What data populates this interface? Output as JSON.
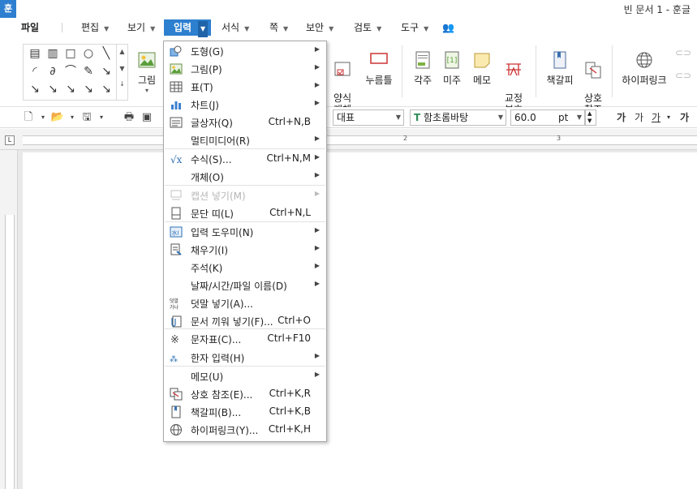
{
  "app": {
    "logo": "훈",
    "title": "빈 문서 1 - 훈글"
  },
  "menubar": {
    "file": "파일",
    "items": [
      "편집",
      "보기",
      "입력",
      "서식",
      "쪽",
      "보안",
      "검토",
      "도구"
    ]
  },
  "ribbon": {
    "picture": "그림",
    "form_object": "양식\n개체",
    "push_button": "누름틀",
    "footnote": "각주",
    "endnote": "미주",
    "memo": "메모",
    "proofread": "교정\n부호",
    "bookmark": "책갈피",
    "cross_ref": "상호\n참조",
    "hyperlink": "하이퍼링크"
  },
  "format_toolbar": {
    "style": "대표",
    "font": "함초롬바탕",
    "font_size": "60.0",
    "unit": "pt",
    "char_buttons": [
      "가",
      "가",
      "가",
      "가"
    ]
  },
  "ruler": {
    "numbers": [
      "2",
      "3"
    ]
  },
  "dropdown": {
    "items": [
      {
        "icon": "shape-icon",
        "label": "도형(G)",
        "shortcut": "",
        "submenu": true,
        "disabled": false
      },
      {
        "icon": "picture-icon",
        "label": "그림(P)",
        "shortcut": "",
        "submenu": true,
        "disabled": false
      },
      {
        "icon": "table-icon",
        "label": "표(T)",
        "shortcut": "",
        "submenu": true,
        "disabled": false
      },
      {
        "icon": "chart-icon",
        "label": "차트(J)",
        "shortcut": "",
        "submenu": true,
        "disabled": false
      },
      {
        "icon": "textbox-icon",
        "label": "글상자(Q)",
        "shortcut": "Ctrl+N,B",
        "submenu": false,
        "disabled": false
      },
      {
        "icon": "",
        "label": "멀티미디어(R)",
        "shortcut": "",
        "submenu": true,
        "disabled": false
      },
      {
        "icon": "equation-icon",
        "label": "수식(S)...",
        "shortcut": "Ctrl+N,M",
        "submenu": true,
        "disabled": false
      },
      {
        "icon": "",
        "label": "개체(O)",
        "shortcut": "",
        "submenu": true,
        "disabled": false
      },
      {
        "icon": "caption-icon",
        "label": "캡션 넣기(M)",
        "shortcut": "",
        "submenu": true,
        "disabled": true
      },
      {
        "icon": "column-break-icon",
        "label": "문단 띠(L)",
        "shortcut": "Ctrl+N,L",
        "submenu": false,
        "disabled": false
      },
      {
        "icon": "input-helper-icon",
        "label": "입력 도우미(N)",
        "shortcut": "",
        "submenu": true,
        "disabled": false
      },
      {
        "icon": "fill-icon",
        "label": "채우기(I)",
        "shortcut": "",
        "submenu": true,
        "disabled": false
      },
      {
        "icon": "",
        "label": "주석(K)",
        "shortcut": "",
        "submenu": true,
        "disabled": false
      },
      {
        "icon": "",
        "label": "날짜/시간/파일 이름(D)",
        "shortcut": "",
        "submenu": true,
        "disabled": false
      },
      {
        "icon": "overlap-icon",
        "label": "덧말 넣기(A)...",
        "shortcut": "",
        "submenu": false,
        "disabled": false
      },
      {
        "icon": "paperclip-icon",
        "label": "문서 끼워 넣기(F)...",
        "shortcut": "Ctrl+O",
        "submenu": false,
        "disabled": false
      },
      {
        "icon": "symbol-icon",
        "label": "문자표(C)...",
        "shortcut": "Ctrl+F10",
        "submenu": false,
        "disabled": false
      },
      {
        "icon": "hanja-icon",
        "label": "한자 입력(H)",
        "shortcut": "",
        "submenu": true,
        "disabled": false
      },
      {
        "icon": "",
        "label": "메모(U)",
        "shortcut": "",
        "submenu": true,
        "disabled": false
      },
      {
        "icon": "cross-ref-icon",
        "label": "상호 참조(E)...",
        "shortcut": "Ctrl+K,R",
        "submenu": false,
        "disabled": false
      },
      {
        "icon": "bookmark-icon",
        "label": "책갈피(B)...",
        "shortcut": "Ctrl+K,B",
        "submenu": false,
        "disabled": false
      },
      {
        "icon": "hyperlink-icon",
        "label": "하이퍼링크(Y)...",
        "shortcut": "Ctrl+K,H",
        "submenu": false,
        "disabled": false
      }
    ]
  }
}
